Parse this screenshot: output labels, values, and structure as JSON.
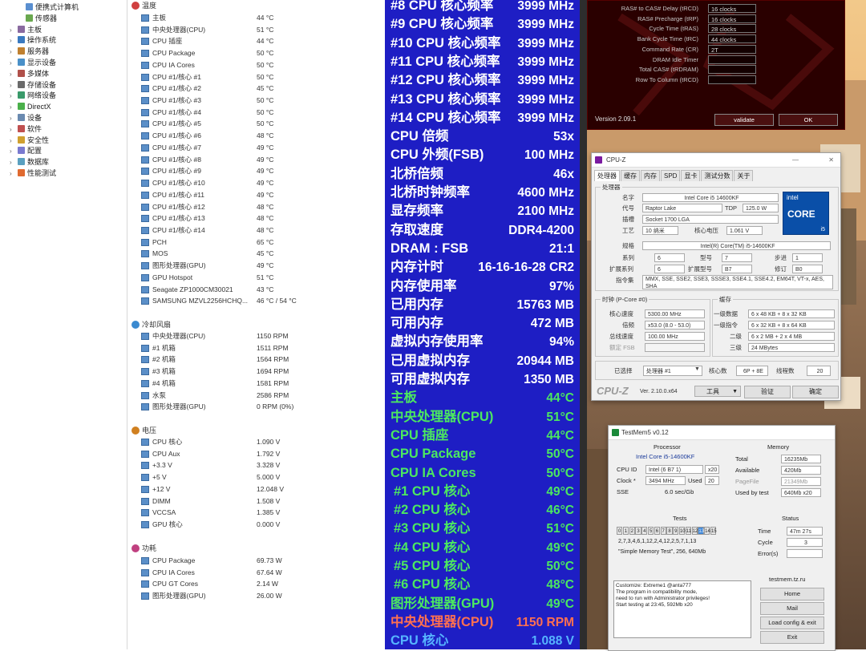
{
  "tree": {
    "items": [
      {
        "label": "便携式计算机",
        "expander": "",
        "icon": "laptop-icon"
      },
      {
        "label": "传感器",
        "expander": "",
        "icon": "sensor-icon"
      },
      {
        "label": "主板",
        "expander": "›",
        "icon": "motherboard-icon"
      },
      {
        "label": "操作系统",
        "expander": "›",
        "icon": "os-icon"
      },
      {
        "label": "服务器",
        "expander": "›",
        "icon": "server-icon"
      },
      {
        "label": "显示设备",
        "expander": "›",
        "icon": "display-icon"
      },
      {
        "label": "多媒体",
        "expander": "›",
        "icon": "multimedia-icon"
      },
      {
        "label": "存储设备",
        "expander": "›",
        "icon": "storage-icon"
      },
      {
        "label": "网络设备",
        "expander": "›",
        "icon": "network-icon"
      },
      {
        "label": "DirectX",
        "expander": "›",
        "icon": "directx-icon"
      },
      {
        "label": "设备",
        "expander": "›",
        "icon": "devices-icon"
      },
      {
        "label": "软件",
        "expander": "›",
        "icon": "software-icon"
      },
      {
        "label": "安全性",
        "expander": "›",
        "icon": "security-icon"
      },
      {
        "label": "配置",
        "expander": "›",
        "icon": "config-icon"
      },
      {
        "label": "数据库",
        "expander": "›",
        "icon": "database-icon"
      },
      {
        "label": "性能测试",
        "expander": "›",
        "icon": "benchmark-icon"
      }
    ]
  },
  "sensors": {
    "temp_section": "温度",
    "temps": [
      {
        "name": "主板",
        "value": "44 °C"
      },
      {
        "name": "中央处理器(CPU)",
        "value": "51 °C"
      },
      {
        "name": "CPU 插座",
        "value": "44 °C"
      },
      {
        "name": "CPU Package",
        "value": "50 °C"
      },
      {
        "name": "CPU IA Cores",
        "value": "50 °C"
      },
      {
        "name": "CPU #1/核心 #1",
        "value": "50 °C"
      },
      {
        "name": "CPU #1/核心 #2",
        "value": "45 °C"
      },
      {
        "name": "CPU #1/核心 #3",
        "value": "50 °C"
      },
      {
        "name": "CPU #1/核心 #4",
        "value": "50 °C"
      },
      {
        "name": "CPU #1/核心 #5",
        "value": "50 °C"
      },
      {
        "name": "CPU #1/核心 #6",
        "value": "48 °C"
      },
      {
        "name": "CPU #1/核心 #7",
        "value": "49 °C"
      },
      {
        "name": "CPU #1/核心 #8",
        "value": "49 °C"
      },
      {
        "name": "CPU #1/核心 #9",
        "value": "49 °C"
      },
      {
        "name": "CPU #1/核心 #10",
        "value": "49 °C"
      },
      {
        "name": "CPU #1/核心 #11",
        "value": "49 °C"
      },
      {
        "name": "CPU #1/核心 #12",
        "value": "48 °C"
      },
      {
        "name": "CPU #1/核心 #13",
        "value": "48 °C"
      },
      {
        "name": "CPU #1/核心 #14",
        "value": "48 °C"
      },
      {
        "name": "PCH",
        "value": "65 °C"
      },
      {
        "name": "MOS",
        "value": "45 °C"
      },
      {
        "name": "图形处理器(GPU)",
        "value": "49 °C"
      },
      {
        "name": "GPU Hotspot",
        "value": "51 °C"
      },
      {
        "name": "Seagate ZP1000CM30021",
        "value": "43 °C"
      },
      {
        "name": "SAMSUNG MZVL2256HCHQ...",
        "value": "46 °C / 54 °C"
      }
    ],
    "fan_section": "冷却风扇",
    "fans": [
      {
        "name": "中央处理器(CPU)",
        "value": "1150 RPM"
      },
      {
        "name": "#1 机箱",
        "value": "1511 RPM"
      },
      {
        "name": "#2 机箱",
        "value": "1564 RPM"
      },
      {
        "name": "#3 机箱",
        "value": "1694 RPM"
      },
      {
        "name": "#4 机箱",
        "value": "1581 RPM"
      },
      {
        "name": "水泵",
        "value": "2586 RPM"
      },
      {
        "name": "图形处理器(GPU)",
        "value": "0 RPM  (0%)"
      }
    ],
    "volt_section": "电压",
    "volts": [
      {
        "name": "CPU 核心",
        "value": "1.090 V"
      },
      {
        "name": "CPU Aux",
        "value": "1.792 V"
      },
      {
        "name": "+3.3 V",
        "value": "3.328 V"
      },
      {
        "name": "+5 V",
        "value": "5.000 V"
      },
      {
        "name": "+12 V",
        "value": "12.048 V"
      },
      {
        "name": "DIMM",
        "value": "1.508 V"
      },
      {
        "name": "VCCSA",
        "value": "1.385 V"
      },
      {
        "name": "GPU 核心",
        "value": "0.000 V"
      }
    ],
    "power_section": "功耗",
    "powers": [
      {
        "name": "CPU Package",
        "value": "69.73 W"
      },
      {
        "name": "CPU IA Cores",
        "value": "67.64 W"
      },
      {
        "name": "CPU GT Cores",
        "value": "2.14 W"
      },
      {
        "name": "图形处理器(GPU)",
        "value": "26.00 W"
      }
    ]
  },
  "osd": {
    "rows": [
      {
        "label": "#8 CPU 核心频率",
        "value": "3999 MHz",
        "color": "#ffffff",
        "indent": false
      },
      {
        "label": "#9 CPU 核心频率",
        "value": "3999 MHz",
        "color": "#ffffff",
        "indent": false
      },
      {
        "label": "#10 CPU 核心频率",
        "value": "3999 MHz",
        "color": "#ffffff",
        "indent": false
      },
      {
        "label": "#11 CPU 核心频率",
        "value": "3999 MHz",
        "color": "#ffffff",
        "indent": false
      },
      {
        "label": "#12 CPU 核心频率",
        "value": "3999 MHz",
        "color": "#ffffff",
        "indent": false
      },
      {
        "label": "#13 CPU 核心频率",
        "value": "3999 MHz",
        "color": "#ffffff",
        "indent": false
      },
      {
        "label": "#14 CPU 核心频率",
        "value": "3999 MHz",
        "color": "#ffffff",
        "indent": false
      },
      {
        "label": "CPU 倍频",
        "value": "53x",
        "color": "#ffffff",
        "indent": false
      },
      {
        "label": "CPU 外频(FSB)",
        "value": "100 MHz",
        "color": "#ffffff",
        "indent": false
      },
      {
        "label": "北桥倍频",
        "value": "46x",
        "color": "#ffffff",
        "indent": false
      },
      {
        "label": "北桥时钟频率",
        "value": "4600 MHz",
        "color": "#ffffff",
        "indent": false
      },
      {
        "label": "显存频率",
        "value": "2100 MHz",
        "color": "#ffffff",
        "indent": false
      },
      {
        "label": "存取速度",
        "value": "DDR4-4200",
        "color": "#ffffff",
        "indent": false
      },
      {
        "label": "DRAM : FSB",
        "value": "21:1",
        "color": "#ffffff",
        "indent": false
      },
      {
        "label": "内存计时",
        "value": "16-16-16-28 CR2",
        "color": "#ffffff",
        "indent": false
      },
      {
        "label": "内存使用率",
        "value": "97%",
        "color": "#ffffff",
        "indent": false
      },
      {
        "label": "已用内存",
        "value": "15763 MB",
        "color": "#ffffff",
        "indent": false
      },
      {
        "label": "可用内存",
        "value": "472 MB",
        "color": "#ffffff",
        "indent": false
      },
      {
        "label": "虚拟内存使用率",
        "value": "94%",
        "color": "#ffffff",
        "indent": false
      },
      {
        "label": "已用虚拟内存",
        "value": "20944 MB",
        "color": "#ffffff",
        "indent": false
      },
      {
        "label": "可用虚拟内存",
        "value": "1350 MB",
        "color": "#ffffff",
        "indent": false
      },
      {
        "label": "主板",
        "value": "44°C",
        "color": "#4ce860",
        "indent": false
      },
      {
        "label": "中央处理器(CPU)",
        "value": "51°C",
        "color": "#4ce860",
        "indent": false
      },
      {
        "label": "CPU 插座",
        "value": "44°C",
        "color": "#4ce860",
        "indent": false
      },
      {
        "label": "CPU Package",
        "value": "50°C",
        "color": "#4ce860",
        "indent": false
      },
      {
        "label": "CPU IA Cores",
        "value": "50°C",
        "color": "#4ce860",
        "indent": false
      },
      {
        "label": "#1 CPU 核心",
        "value": "49°C",
        "color": "#4ce860",
        "indent": true
      },
      {
        "label": "#2 CPU 核心",
        "value": "46°C",
        "color": "#4ce860",
        "indent": true
      },
      {
        "label": "#3 CPU 核心",
        "value": "51°C",
        "color": "#4ce860",
        "indent": true
      },
      {
        "label": "#4 CPU 核心",
        "value": "49°C",
        "color": "#4ce860",
        "indent": true
      },
      {
        "label": "#5 CPU 核心",
        "value": "50°C",
        "color": "#4ce860",
        "indent": true
      },
      {
        "label": "#6 CPU 核心",
        "value": "48°C",
        "color": "#4ce860",
        "indent": true
      },
      {
        "label": "图形处理器(GPU)",
        "value": "49°C",
        "color": "#4ce860",
        "indent": false
      },
      {
        "label": "中央处理器(CPU)",
        "value": "1150 RPM",
        "color": "#ff7050",
        "indent": false
      },
      {
        "label": "CPU 核心",
        "value": "1.088 V",
        "color": "#56b4ff",
        "indent": false
      }
    ]
  },
  "ram_tool": {
    "rows": [
      {
        "label": "RAS# to CAS# Delay (tRCD)",
        "value": "16 clocks"
      },
      {
        "label": "RAS# Precharge (tRP)",
        "value": "16 clocks"
      },
      {
        "label": "Cycle Time (tRAS)",
        "value": "28 clocks"
      },
      {
        "label": "Bank Cycle Time (tRC)",
        "value": "44 clocks"
      },
      {
        "label": "Command Rate (CR)",
        "value": "2T"
      },
      {
        "label": "DRAM Idle Timer",
        "value": ""
      },
      {
        "label": "Total CAS# (tRDRAM)",
        "value": ""
      },
      {
        "label": "Row To Column (tRCD)",
        "value": ""
      }
    ],
    "version": "Version 2.09.1",
    "validate_button": "validate",
    "ok_button": "OK"
  },
  "cpuz": {
    "title": "CPU-Z",
    "tabs": [
      "处理器",
      "缓存",
      "内存",
      "SPD",
      "显卡",
      "测试分数",
      "关于"
    ],
    "processor_group": "处理器",
    "name_label": "名字",
    "name": "Intel Core i5 14600KF",
    "codename_label": "代号",
    "codename": "Raptor Lake",
    "tdp_label": "TDP",
    "tdp": "125.0 W",
    "package_label": "插槽",
    "package": "Socket 1700 LGA",
    "tech_label": "工艺",
    "tech": "10 纳米",
    "vcore_label": "核心电压",
    "vcore": "1.061 V",
    "spec_label": "规格",
    "spec": "Intel(R) Core(TM) i5-14600KF",
    "family_label": "系列",
    "family": "6",
    "model_label": "型号",
    "model": "7",
    "stepping_label": "步进",
    "stepping": "1",
    "extfamily_label": "扩展系列",
    "extfamily": "6",
    "extmodel_label": "扩展型号",
    "extmodel": "B7",
    "revision_label": "修订",
    "revision": "B0",
    "instr_label": "指令集",
    "instructions": "MMX, SSE, SSE2, SSE3, SSSE3, SSE4.1, SSE4.2, EM64T, VT-x, AES, SHA",
    "clock_group": "时钟 (P-Core #0)",
    "corespeed_label": "核心速度",
    "corespeed": "5300.00 MHz",
    "multiplier_label": "倍频",
    "multiplier": "x53.0 (8.0 - 53.0)",
    "busspeed_label": "总线速度",
    "busspeed": "100.00 MHz",
    "fsb_label": "额定 FSB",
    "fsb": "",
    "cache_group": "缓存",
    "l1d_label": "一级数据",
    "l1d": "6 x 48 KB + 8 x 32 KB",
    "l1i_label": "一级指令",
    "l1i": "6 x 32 KB + 8 x 64 KB",
    "l2_label": "二级",
    "l2": "6 x 2 MB + 2 x 4 MB",
    "l3_label": "三级",
    "l3": "24 MBytes",
    "selected_label": "已选择",
    "selected": "处理器 #1",
    "cores_label": "核心数",
    "cores": "6P + 8E",
    "threads_label": "线程数",
    "threads": "20",
    "logo_text": "CPU-Z",
    "version": "Ver. 2.10.0.x64",
    "tools_button": "工具",
    "validate_button": "验证",
    "ok_button": "确定",
    "intel_logo": "intel",
    "core_logo": "CORE",
    "i_logo": "i5"
  },
  "tm5": {
    "title": "TestMem5 v0.12",
    "processor_header": "Processor",
    "cpu_name": "Intel Core i5-14600KF",
    "cpuid_label": "CPU ID",
    "cpuid": "Intel (6 B7 1)",
    "cpuid_count": "x20",
    "clock_label": "Clock *",
    "clock": "3494 MHz",
    "used_label": "Used",
    "used": "20",
    "sse_label": "SSE",
    "sse": "6.0 sec/Gb",
    "memory_header": "Memory",
    "total_label": "Total",
    "total": "16235Mb",
    "avail_label": "Available",
    "avail": "420Mb",
    "pagefile_label": "PageFile",
    "pagefile": "21349Mb",
    "usedbytest_label": "Used by test",
    "usedbytest": "640Mb x20",
    "tests_header": "Tests",
    "test_cells": [
      "0",
      "1",
      "2",
      "3",
      "4",
      "5",
      "6",
      "7",
      "8",
      "9",
      "10",
      "11",
      "12",
      "13",
      "14",
      "15"
    ],
    "active_test": "13",
    "sequence": "2,7,3,4,6,1,12,2,4,12,2,5,7,1,13",
    "test_info": "\"Simple Memory Test\", 256, 640Mb",
    "status_header": "Status",
    "time_label": "Time",
    "time": "47m 27s",
    "cycle_label": "Cycle",
    "cycle": "3",
    "errors_label": "Error(s)",
    "errors": "",
    "log": "Customize: Extreme1 @anta777\nThe program in compatibility mode,\nneed to run with Administrator privileges!\nStart testing at 23:45, 592Mb x20",
    "site": "testmem.tz.ru",
    "home_button": "Home",
    "mail_button": "Mail",
    "load_button": "Load config & exit",
    "exit_button": "Exit"
  }
}
